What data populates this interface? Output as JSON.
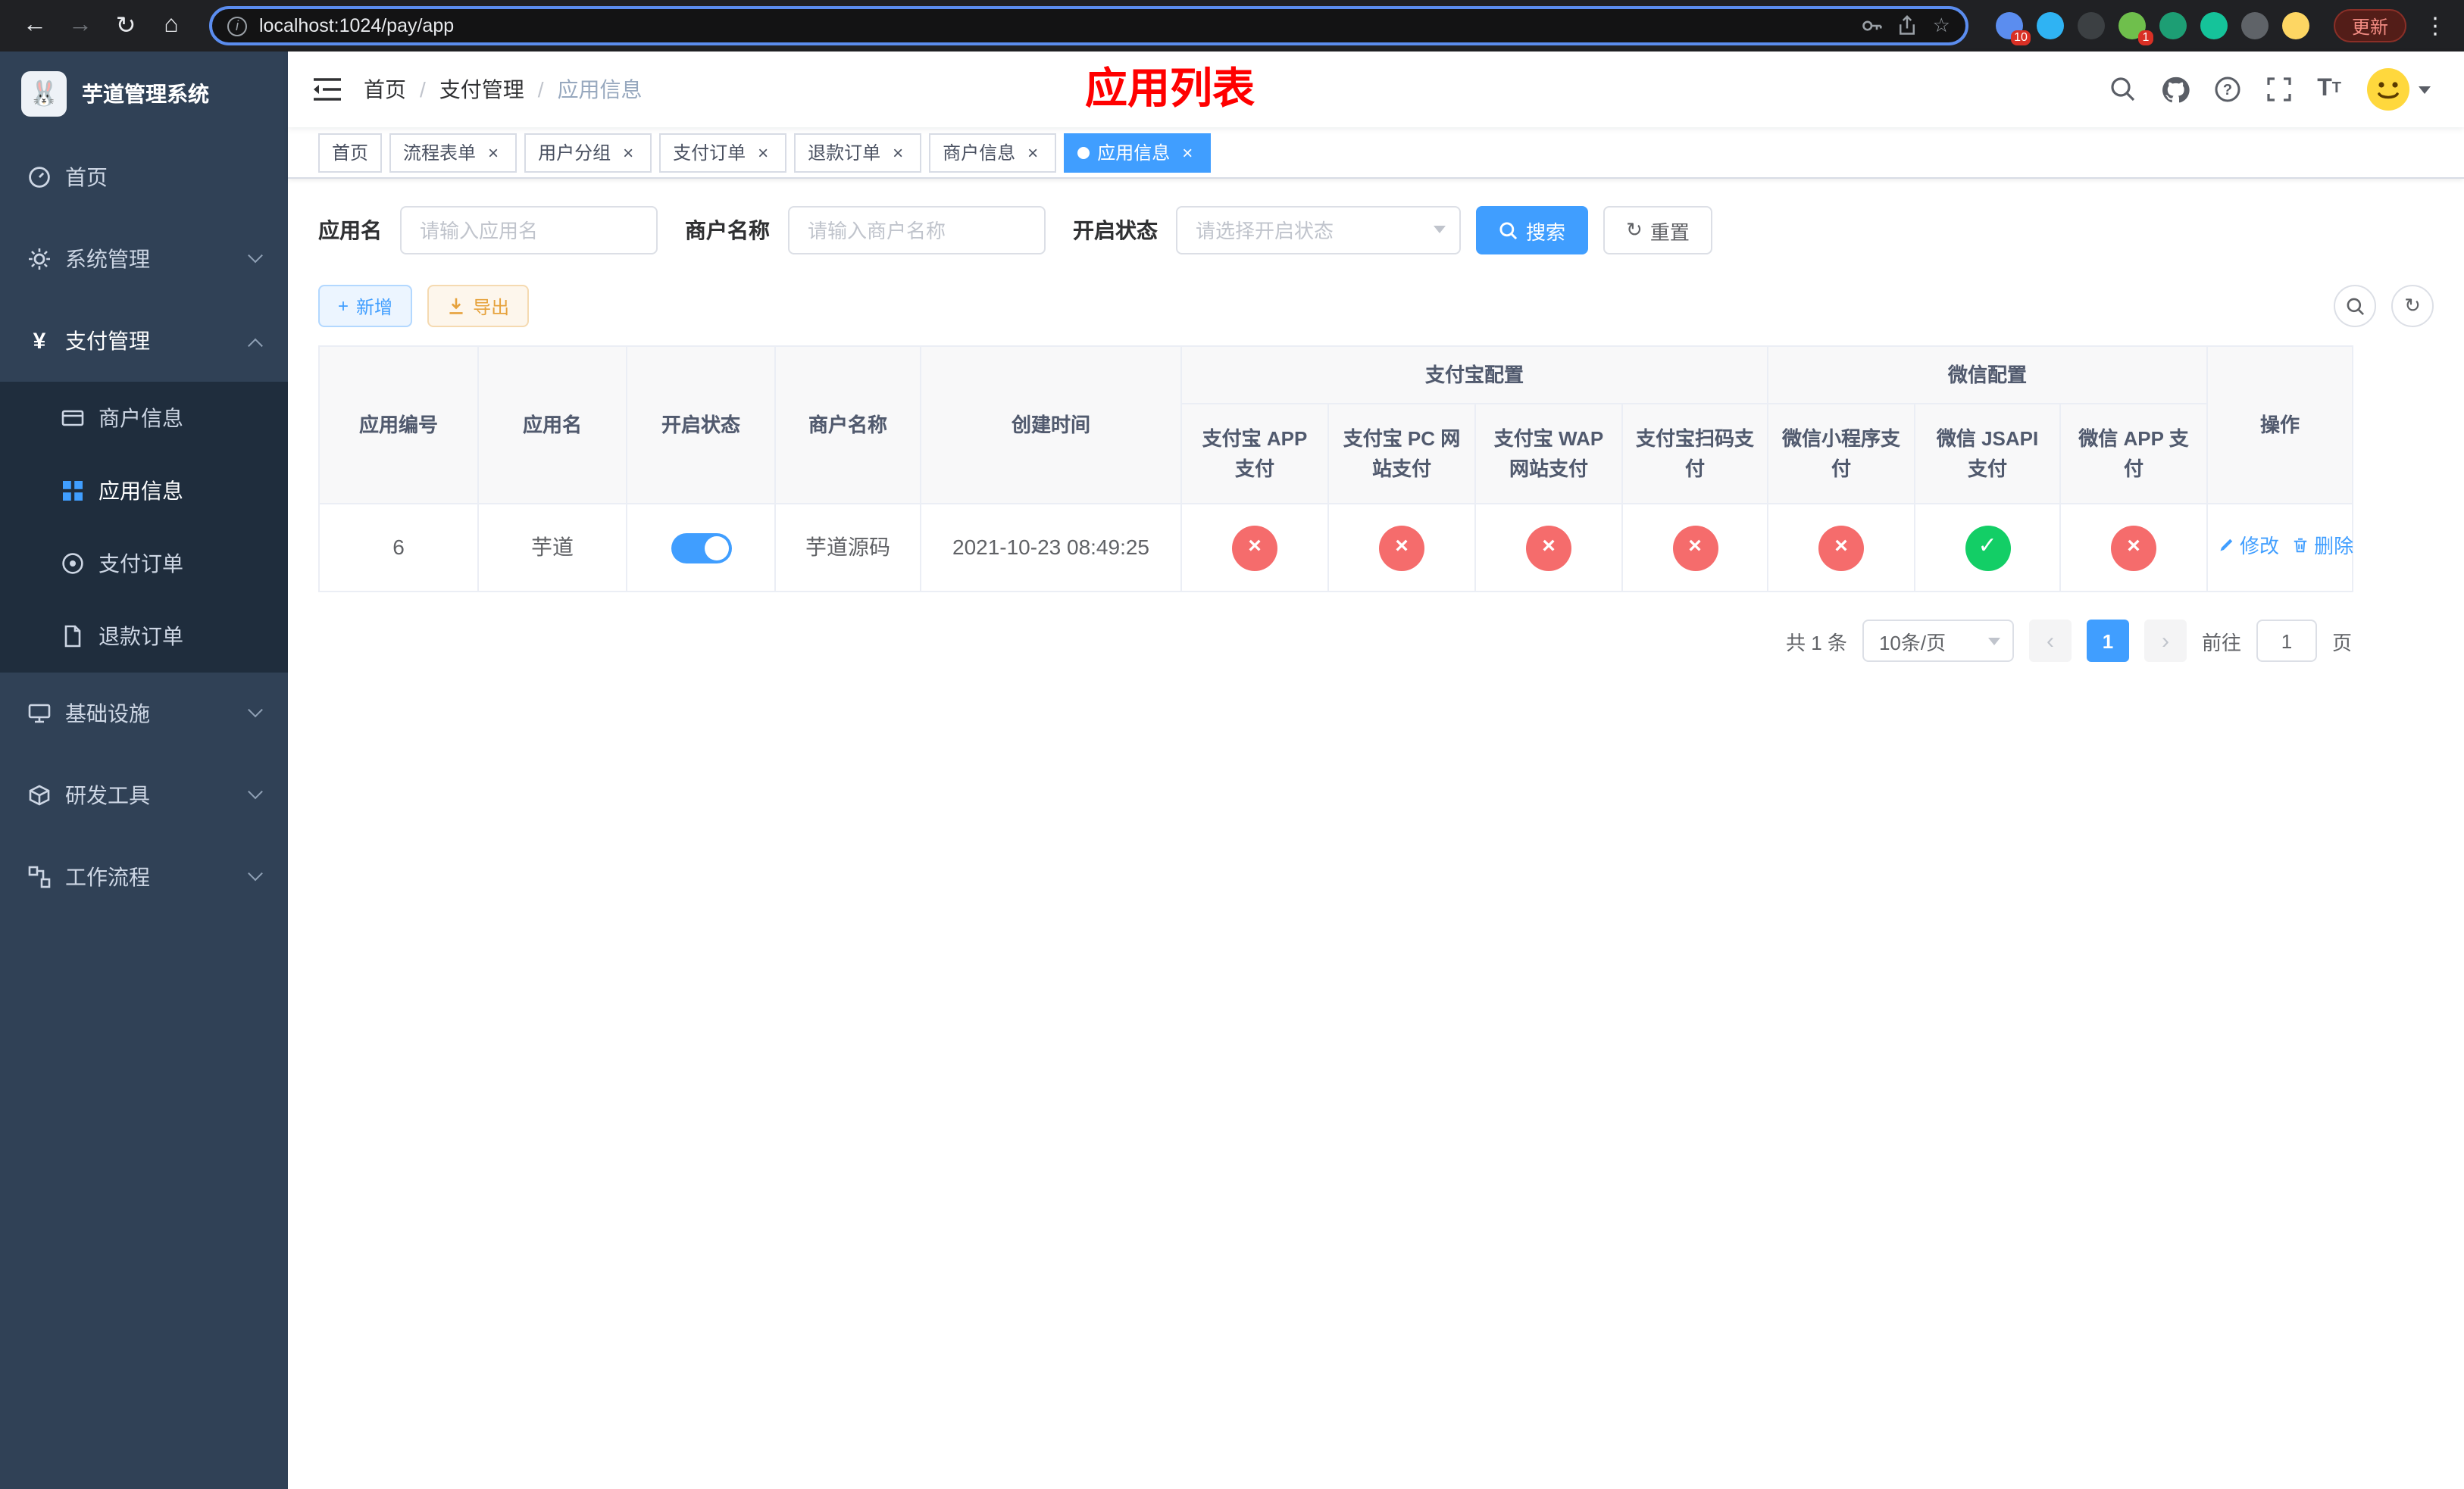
{
  "colors": {
    "primary": "#409eff",
    "success": "#13ce66",
    "danger": "#f56c6c",
    "title_red": "#ff0000",
    "sidebar_bg": "#304156",
    "submenu_bg": "#1f2d3d"
  },
  "icons": {
    "back": "←",
    "forward": "→",
    "reload": "↻",
    "home": "⌂",
    "info": "i",
    "star": "☆",
    "dots": "⋮",
    "question": "?",
    "text_large": "T",
    "text_small": "T",
    "yen": "¥",
    "plus": "+",
    "refresh": "↻",
    "check": "✓",
    "cross": "×",
    "close": "×",
    "prev": "‹",
    "next": "›",
    "logo_face": "🐰"
  },
  "browser": {
    "url": "localhost:1024/pay/app",
    "update_label": "更新",
    "extensions": [
      {
        "name": "extension-icon-1",
        "color": "#5b8def",
        "badge": "10"
      },
      {
        "name": "extension-icon-2",
        "color": "#2fb3f3",
        "badge": ""
      },
      {
        "name": "extension-icon-3",
        "color": "#3c4043",
        "badge": ""
      },
      {
        "name": "extension-icon-4",
        "color": "#6fbf4c",
        "badge": "1"
      },
      {
        "name": "extension-icon-5",
        "color": "#1d9e74",
        "badge": ""
      },
      {
        "name": "extension-icon-6",
        "color": "#15c39a",
        "badge": ""
      },
      {
        "name": "extension-icon-7",
        "color": "#5f6368",
        "badge": ""
      },
      {
        "name": "extension-icon-8",
        "color": "#fdd663",
        "badge": ""
      }
    ]
  },
  "sidebar": {
    "logo_title": "芋道管理系统",
    "menu": [
      {
        "label": "首页"
      },
      {
        "label": "系统管理"
      },
      {
        "label": "支付管理"
      },
      {
        "label": "基础设施"
      },
      {
        "label": "研发工具"
      },
      {
        "label": "工作流程"
      }
    ],
    "submenu": [
      {
        "label": "商户信息"
      },
      {
        "label": "应用信息"
      },
      {
        "label": "支付订单"
      },
      {
        "label": "退款订单"
      }
    ]
  },
  "header": {
    "breadcrumb": [
      "首页",
      "支付管理",
      "应用信息"
    ],
    "page_title": "应用列表"
  },
  "tabs": [
    {
      "label": "首页"
    },
    {
      "label": "流程表单"
    },
    {
      "label": "用户分组"
    },
    {
      "label": "支付订单"
    },
    {
      "label": "退款订单"
    },
    {
      "label": "商户信息"
    },
    {
      "label": "应用信息"
    }
  ],
  "filter": {
    "app_name_label": "应用名",
    "app_name_placeholder": "请输入应用名",
    "merchant_label": "商户名称",
    "merchant_placeholder": "请输入商户名称",
    "status_label": "开启状态",
    "status_placeholder": "请选择开启状态",
    "search_label": "搜索",
    "reset_label": "重置"
  },
  "toolbar": {
    "add_label": "新增",
    "export_label": "导出"
  },
  "table": {
    "groups": {
      "alipay": "支付宝配置",
      "wechat": "微信配置"
    },
    "columns": {
      "id": "应用编号",
      "name": "应用名",
      "status": "开启状态",
      "merchant": "商户名称",
      "created": "创建时间",
      "action": "操作",
      "alipay_cols": [
        "支付宝 APP 支付",
        "支付宝 PC 网站支付",
        "支付宝 WAP 网站支付",
        "支付宝扫码支付"
      ],
      "wechat_cols": [
        "微信小程序支付",
        "微信 JSAPI 支付",
        "微信 APP 支付"
      ]
    },
    "rows": [
      {
        "id": "6",
        "name": "芋道",
        "enabled": true,
        "merchant": "芋道源码",
        "created": "2021-10-23 08:49:25",
        "configs": [
          false,
          false,
          false,
          false,
          false,
          true,
          false
        ],
        "edit_label": "修改",
        "delete_label": "删除"
      }
    ]
  },
  "pagination": {
    "total_text": "共 1 条",
    "page_size": "10条/页",
    "current_page": "1",
    "goto_label": "前往",
    "goto_value": "1",
    "page_suffix": "页"
  }
}
